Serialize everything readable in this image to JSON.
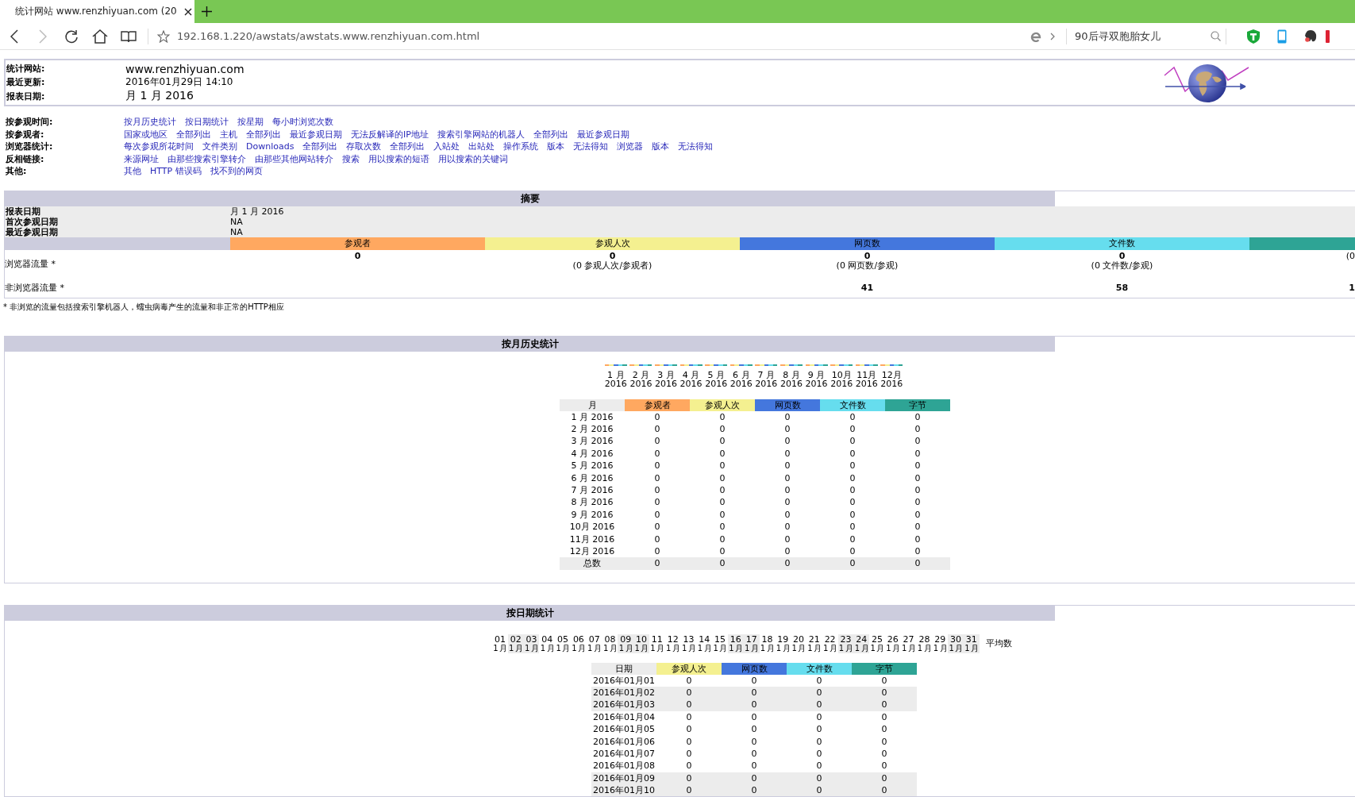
{
  "browser": {
    "tab_title": "统计网站 www.renzhiyuan.com (20",
    "url": "192.168.1.220/awstats/awstats.www.renzhiyuan.com.html",
    "search": "90后寻双胞胎女儿"
  },
  "header": [
    {
      "label": "统计网站:",
      "value": "www.renzhiyuan.com"
    },
    {
      "label": "最近更新:",
      "value": "2016年01月29日 14:10"
    },
    {
      "label": "报表日期:",
      "value": "月 1 月 2016"
    }
  ],
  "nav": [
    {
      "label": "按参观时间:",
      "links": [
        "按月历史统计",
        "按日期统计",
        "按星期",
        "每小时浏览次数"
      ]
    },
    {
      "label": "按参观者:",
      "links": [
        "国家或地区",
        "全部列出",
        "主机",
        "全部列出",
        "最近参观日期",
        "无法反解译的IP地址",
        "搜索引擎网站的机器人",
        "全部列出",
        "最近参观日期"
      ]
    },
    {
      "label": "浏览器统计:",
      "links": [
        "每次参观所花时间",
        "文件类别",
        "Downloads",
        "全部列出",
        "存取次数",
        "全部列出",
        "入站处",
        "出站处",
        "操作系统",
        "版本",
        "无法得知",
        "浏览器",
        "版本",
        "无法得知"
      ]
    },
    {
      "label": "反相链接:",
      "links": [
        "来源网址",
        "由那些搜索引擎转介",
        "由那些其他网站转介",
        "搜索",
        "用以搜索的短语",
        "用以搜索的关键词"
      ]
    },
    {
      "label": "其他:",
      "links": [
        "其他",
        "HTTP 错误码",
        "找不到的网页"
      ]
    }
  ],
  "summary": {
    "title": "摘要",
    "info": [
      {
        "label": "报表日期",
        "value": "月 1 月 2016"
      },
      {
        "label": "首次参观日期",
        "value": "NA"
      },
      {
        "label": "最近参观日期",
        "value": "NA"
      }
    ],
    "columns": [
      {
        "label": "参观者",
        "color": "#ffa860"
      },
      {
        "label": "参观人次",
        "color": "#f4f090"
      },
      {
        "label": "网页数",
        "color": "#4477dd"
      },
      {
        "label": "文件数",
        "color": "#66ddee"
      },
      {
        "color": "#2ea495"
      }
    ],
    "rows": [
      {
        "label": "浏览器流量 *",
        "cells": [
          {
            "value": "0"
          },
          {
            "value": "0",
            "note": "(0 参观人次/参观者)"
          },
          {
            "value": "0",
            "note": "(0 网页数/参观)"
          },
          {
            "value": "0",
            "note": "(0 文件数/参观)"
          },
          {
            "note": "(0"
          }
        ]
      },
      {
        "label": "非浏览器流量 *",
        "cells": [
          null,
          null,
          {
            "value": "41"
          },
          {
            "value": "58"
          },
          {
            "value": "1"
          }
        ]
      }
    ],
    "footnote": "* 非浏览的流量包括搜索引擎机器人，蠕虫病毒产生的流量和非正常的HTTP相应"
  },
  "monthly": {
    "title": "按月历史统计",
    "chart_labels": [
      {
        "month": "1 月",
        "year": "2016"
      },
      {
        "month": "2 月",
        "year": "2016"
      },
      {
        "month": "3 月",
        "year": "2016"
      },
      {
        "month": "4 月",
        "year": "2016"
      },
      {
        "month": "5 月",
        "year": "2016"
      },
      {
        "month": "6 月",
        "year": "2016"
      },
      {
        "month": "7 月",
        "year": "2016"
      },
      {
        "month": "8 月",
        "year": "2016"
      },
      {
        "month": "9 月",
        "year": "2016"
      },
      {
        "month": "10月",
        "year": "2016"
      },
      {
        "month": "11月",
        "year": "2016"
      },
      {
        "month": "12月",
        "year": "2016"
      }
    ],
    "columns": [
      {
        "label": "月"
      },
      {
        "label": "参观者",
        "color": "#ffa860"
      },
      {
        "label": "参观人次",
        "color": "#f4f090"
      },
      {
        "label": "网页数",
        "color": "#4477dd"
      },
      {
        "label": "文件数",
        "color": "#66ddee"
      },
      {
        "label": "字节",
        "color": "#2ea495"
      }
    ],
    "rows": [
      {
        "label": "1 月 2016",
        "values": [
          "0",
          "0",
          "0",
          "0",
          "0"
        ]
      },
      {
        "label": "2 月 2016",
        "values": [
          "0",
          "0",
          "0",
          "0",
          "0"
        ]
      },
      {
        "label": "3 月 2016",
        "values": [
          "0",
          "0",
          "0",
          "0",
          "0"
        ]
      },
      {
        "label": "4 月 2016",
        "values": [
          "0",
          "0",
          "0",
          "0",
          "0"
        ]
      },
      {
        "label": "5 月 2016",
        "values": [
          "0",
          "0",
          "0",
          "0",
          "0"
        ]
      },
      {
        "label": "6 月 2016",
        "values": [
          "0",
          "0",
          "0",
          "0",
          "0"
        ]
      },
      {
        "label": "7 月 2016",
        "values": [
          "0",
          "0",
          "0",
          "0",
          "0"
        ]
      },
      {
        "label": "8 月 2016",
        "values": [
          "0",
          "0",
          "0",
          "0",
          "0"
        ]
      },
      {
        "label": "9 月 2016",
        "values": [
          "0",
          "0",
          "0",
          "0",
          "0"
        ]
      },
      {
        "label": "10月 2016",
        "values": [
          "0",
          "0",
          "0",
          "0",
          "0"
        ]
      },
      {
        "label": "11月 2016",
        "values": [
          "0",
          "0",
          "0",
          "0",
          "0"
        ]
      },
      {
        "label": "12月 2016",
        "values": [
          "0",
          "0",
          "0",
          "0",
          "0"
        ]
      }
    ],
    "total": {
      "label": "总数",
      "values": [
        "0",
        "0",
        "0",
        "0",
        "0"
      ]
    }
  },
  "daily": {
    "title": "按日期统计",
    "days": [
      {
        "day": "01",
        "month": "1 月",
        "weekend": false
      },
      {
        "day": "02",
        "month": "1 月",
        "weekend": true
      },
      {
        "day": "03",
        "month": "1 月",
        "weekend": true
      },
      {
        "day": "04",
        "month": "1 月",
        "weekend": false
      },
      {
        "day": "05",
        "month": "1 月",
        "weekend": false
      },
      {
        "day": "06",
        "month": "1 月",
        "weekend": false
      },
      {
        "day": "07",
        "month": "1 月",
        "weekend": false
      },
      {
        "day": "08",
        "month": "1 月",
        "weekend": false
      },
      {
        "day": "09",
        "month": "1 月",
        "weekend": true
      },
      {
        "day": "10",
        "month": "1 月",
        "weekend": true
      },
      {
        "day": "11",
        "month": "1 月",
        "weekend": false
      },
      {
        "day": "12",
        "month": "1 月",
        "weekend": false
      },
      {
        "day": "13",
        "month": "1 月",
        "weekend": false
      },
      {
        "day": "14",
        "month": "1 月",
        "weekend": false
      },
      {
        "day": "15",
        "month": "1 月",
        "weekend": false
      },
      {
        "day": "16",
        "month": "1 月",
        "weekend": true
      },
      {
        "day": "17",
        "month": "1 月",
        "weekend": true
      },
      {
        "day": "18",
        "month": "1 月",
        "weekend": false
      },
      {
        "day": "19",
        "month": "1 月",
        "weekend": false
      },
      {
        "day": "20",
        "month": "1 月",
        "weekend": false
      },
      {
        "day": "21",
        "month": "1 月",
        "weekend": false
      },
      {
        "day": "22",
        "month": "1 月",
        "weekend": false
      },
      {
        "day": "23",
        "month": "1 月",
        "weekend": true
      },
      {
        "day": "24",
        "month": "1 月",
        "weekend": true
      },
      {
        "day": "25",
        "month": "1 月",
        "weekend": false
      },
      {
        "day": "26",
        "month": "1 月",
        "weekend": false
      },
      {
        "day": "27",
        "month": "1 月",
        "weekend": false
      },
      {
        "day": "28",
        "month": "1 月",
        "weekend": false
      },
      {
        "day": "29",
        "month": "1 月",
        "weekend": false
      },
      {
        "day": "30",
        "month": "1 月",
        "weekend": true
      },
      {
        "day": "31",
        "month": "1 月",
        "weekend": true
      }
    ],
    "average_label": "平均数",
    "columns": [
      {
        "label": "日期"
      },
      {
        "label": "参观人次",
        "color": "#f4f090"
      },
      {
        "label": "网页数",
        "color": "#4477dd"
      },
      {
        "label": "文件数",
        "color": "#66ddee"
      },
      {
        "label": "字节",
        "color": "#2ea495"
      }
    ],
    "rows": [
      {
        "label": "2016年01月01",
        "weekend": false,
        "values": [
          "0",
          "0",
          "0",
          "0"
        ]
      },
      {
        "label": "2016年01月02",
        "weekend": true,
        "values": [
          "0",
          "0",
          "0",
          "0"
        ]
      },
      {
        "label": "2016年01月03",
        "weekend": true,
        "values": [
          "0",
          "0",
          "0",
          "0"
        ]
      },
      {
        "label": "2016年01月04",
        "weekend": false,
        "values": [
          "0",
          "0",
          "0",
          "0"
        ]
      },
      {
        "label": "2016年01月05",
        "weekend": false,
        "values": [
          "0",
          "0",
          "0",
          "0"
        ]
      },
      {
        "label": "2016年01月06",
        "weekend": false,
        "values": [
          "0",
          "0",
          "0",
          "0"
        ]
      },
      {
        "label": "2016年01月07",
        "weekend": false,
        "values": [
          "0",
          "0",
          "0",
          "0"
        ]
      },
      {
        "label": "2016年01月08",
        "weekend": false,
        "values": [
          "0",
          "0",
          "0",
          "0"
        ]
      },
      {
        "label": "2016年01月09",
        "weekend": true,
        "values": [
          "0",
          "0",
          "0",
          "0"
        ]
      },
      {
        "label": "2016年01月10",
        "weekend": true,
        "values": [
          "0",
          "0",
          "0",
          "0"
        ]
      }
    ]
  }
}
